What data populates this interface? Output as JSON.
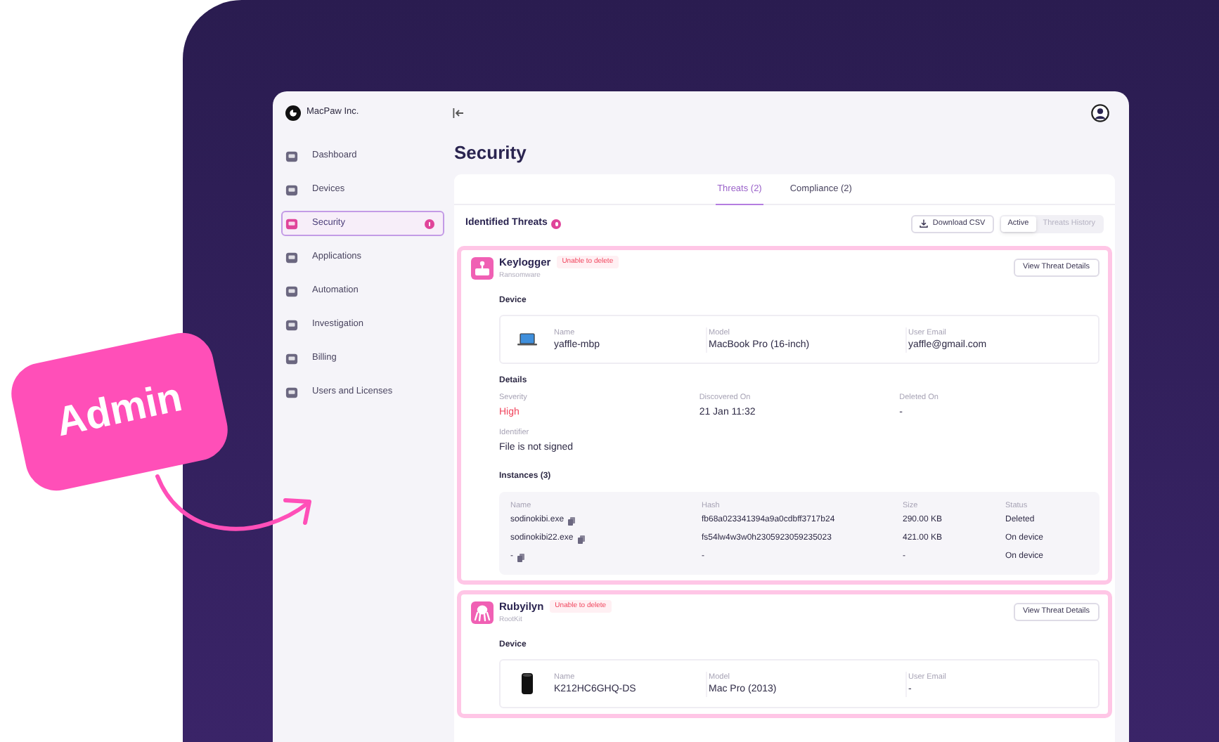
{
  "sticker": {
    "label": "Admin"
  },
  "org": {
    "name": "MacPaw Inc."
  },
  "sidebar": {
    "items": [
      {
        "label": "Dashboard",
        "selected": false,
        "alert": false
      },
      {
        "label": "Devices",
        "selected": false,
        "alert": false
      },
      {
        "label": "Security",
        "selected": true,
        "alert": true
      },
      {
        "label": "Applications",
        "selected": false,
        "alert": false
      },
      {
        "label": "Automation",
        "selected": false,
        "alert": false
      },
      {
        "label": "Investigation",
        "selected": false,
        "alert": false
      },
      {
        "label": "Billing",
        "selected": false,
        "alert": false
      },
      {
        "label": "Users and Licenses",
        "selected": false,
        "alert": false
      }
    ]
  },
  "page": {
    "title": "Security"
  },
  "tabs": [
    {
      "label": "Threats (2)",
      "selected": true
    },
    {
      "label": "Compliance (2)",
      "selected": false
    }
  ],
  "section": {
    "title": "Identified Threats",
    "alert": true
  },
  "download_button": {
    "label": "Download CSV"
  },
  "filter": [
    {
      "label": "Active",
      "selected": true
    },
    {
      "label": "Threats History",
      "selected": false
    }
  ],
  "threats": [
    {
      "name": "Keylogger",
      "type": "Ransomware",
      "badge": "Unable to delete",
      "button": "View Threat Details",
      "device_title": "Device",
      "device": {
        "kind": "laptop",
        "fields": [
          {
            "label": "Name",
            "value": "yaffle-mbp"
          },
          {
            "label": "Model",
            "value": "MacBook Pro (16-inch)"
          },
          {
            "label": "User Email",
            "value": "yaffle@gmail.com"
          }
        ]
      },
      "details_title": "Details",
      "details": [
        {
          "label": "Severity",
          "value": "High",
          "critical": true
        },
        {
          "label": "Discovered On",
          "value": "21 Jan 11:32",
          "critical": false
        },
        {
          "label": "Deleted On",
          "value": "-",
          "critical": false
        },
        {
          "label": "Identifier",
          "value": "File is not signed",
          "critical": false
        }
      ],
      "instances": {
        "title": "Instances (3)",
        "columns": [
          "Name",
          "Hash",
          "Size",
          "Status"
        ],
        "rows": [
          [
            "sodinokibi.exe",
            "fb68a023341394a9a0cdbff3717b24",
            "290.00 KB",
            "Deleted"
          ],
          [
            "sodinokibi22.exe",
            "fs54lw4w3w0h2305923059235023",
            "421.00 KB",
            "On device"
          ],
          [
            "-",
            "-",
            "-",
            "On device"
          ]
        ]
      }
    },
    {
      "name": "Rubyilyn",
      "type": "RootKit",
      "badge": "Unable to delete",
      "button": "View Threat Details",
      "device_title": "Device",
      "device": {
        "kind": "tower",
        "fields": [
          {
            "label": "Name",
            "value": "K212HC6GHQ-DS"
          },
          {
            "label": "Model",
            "value": "Mac Pro (2013)"
          },
          {
            "label": "User Email",
            "value": "-"
          }
        ]
      }
    }
  ]
}
